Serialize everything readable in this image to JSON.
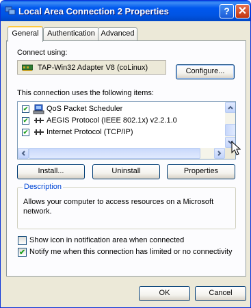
{
  "window": {
    "title": "Local Area Connection 2 Properties",
    "help_glyph": "?",
    "close_glyph": "✕"
  },
  "tabs": [
    {
      "label": "General"
    },
    {
      "label": "Authentication"
    },
    {
      "label": "Advanced"
    }
  ],
  "general": {
    "connect_using_label": "Connect using:",
    "adapter_name": "TAP-Win32 Adapter V8 (coLinux)",
    "configure_label": "Configure...",
    "items_label": "This connection uses the following items:",
    "items": [
      {
        "label": "QoS Packet Scheduler",
        "checked": true,
        "icon": "scheduler-icon"
      },
      {
        "label": "AEGIS Protocol (IEEE 802.1x) v2.2.1.0",
        "checked": true,
        "icon": "protocol-icon"
      },
      {
        "label": "Internet Protocol (TCP/IP)",
        "checked": true,
        "icon": "protocol-icon"
      }
    ],
    "install_label": "Install...",
    "uninstall_label": "Uninstall",
    "properties_label": "Properties",
    "description_title": "Description",
    "description_text": "Allows your computer to access resources on a Microsoft network.",
    "show_icon_label": "Show icon in notification area when connected",
    "show_icon_checked": false,
    "notify_label": "Notify me when this connection has limited or no connectivity",
    "notify_checked": true
  },
  "buttons": {
    "ok": "OK",
    "cancel": "Cancel"
  },
  "check_glyph": "✔"
}
